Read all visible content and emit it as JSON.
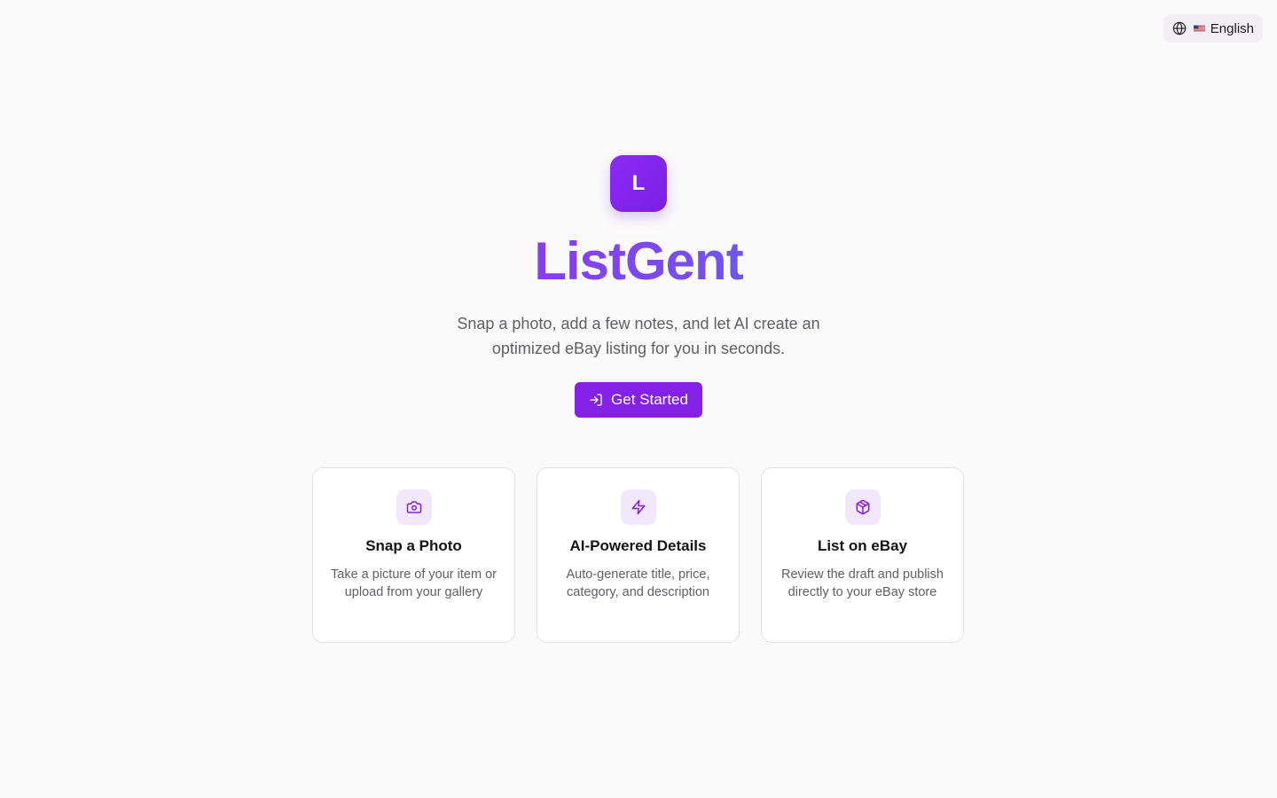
{
  "language_switcher": {
    "label": "English",
    "icon": "globe-icon",
    "flag": "us-flag-icon"
  },
  "hero": {
    "logo_letter": "L",
    "title": "ListGent",
    "tagline": "Snap a photo, add a few notes, and let AI create an optimized eBay listing for you in seconds.",
    "cta_label": "Get Started",
    "cta_icon": "log-in-icon"
  },
  "features": [
    {
      "icon": "camera-icon",
      "title": "Snap a Photo",
      "description": "Take a picture of your item or upload from your gallery"
    },
    {
      "icon": "lightning-icon",
      "title": "AI-Powered Details",
      "description": "Auto-generate title, price, category, and description"
    },
    {
      "icon": "package-icon",
      "title": "List on eBay",
      "description": "Review the draft and publish directly to your eBay store"
    }
  ],
  "colors": {
    "background": "#fafafa",
    "accent": "#8420e8",
    "title_gradient_start": "#8a3cf2",
    "title_gradient_end": "#6f55ee",
    "icon_tile": "#f2e8fd",
    "muted_text": "#5f5f66"
  }
}
